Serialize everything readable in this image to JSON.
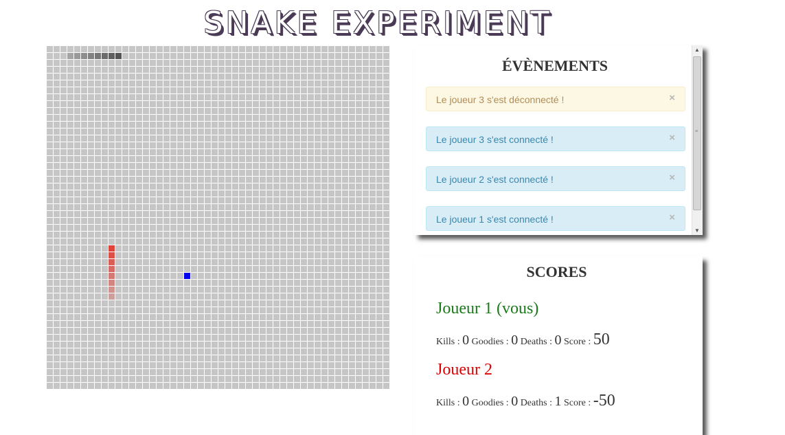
{
  "title": "SNAKE EXPERIMENT",
  "board": {
    "cols": 50,
    "rows": 50,
    "snakes": [
      {
        "color": "#555555",
        "cells": [
          [
            3,
            1
          ],
          [
            4,
            1
          ],
          [
            5,
            1
          ],
          [
            6,
            1
          ],
          [
            7,
            1
          ],
          [
            8,
            1
          ],
          [
            9,
            1
          ],
          [
            10,
            1
          ]
        ],
        "fade": "head-right"
      },
      {
        "color": "#e0433a",
        "cells": [
          [
            9,
            29
          ],
          [
            9,
            30
          ],
          [
            9,
            31
          ],
          [
            9,
            32
          ],
          [
            9,
            33
          ],
          [
            9,
            34
          ],
          [
            9,
            35
          ],
          [
            9,
            36
          ]
        ],
        "fade": "head-top"
      }
    ],
    "goodie": {
      "color": "#0000ee",
      "cell": [
        20,
        33
      ]
    }
  },
  "events": {
    "heading": "ÉVÈNEMENTS",
    "items": [
      {
        "type": "warning",
        "text": "Le joueur 3 s'est déconnecté !",
        "close": "×"
      },
      {
        "type": "info",
        "text": "Le joueur 3 s'est connecté !",
        "close": "×"
      },
      {
        "type": "info",
        "text": "Le joueur 2 s'est connecté !",
        "close": "×"
      },
      {
        "type": "info",
        "text": "Le joueur 1 s'est connecté !",
        "close": "×"
      }
    ]
  },
  "scores": {
    "heading": "SCORES",
    "players": [
      {
        "name": "Joueur 1 (vous)",
        "color": "#1a7a1a",
        "kills_label": "Kills :",
        "kills": "0",
        "goodies_label": "Goodies :",
        "goodies": "0",
        "deaths_label": "Deaths :",
        "deaths": "0",
        "score_label": "Score :",
        "score": "50"
      },
      {
        "name": "Joueur 2",
        "color": "#dd0000",
        "kills_label": "Kills :",
        "kills": "0",
        "goodies_label": "Goodies :",
        "goodies": "0",
        "deaths_label": "Deaths :",
        "deaths": "1",
        "score_label": "Score :",
        "score": "-50"
      }
    ]
  }
}
